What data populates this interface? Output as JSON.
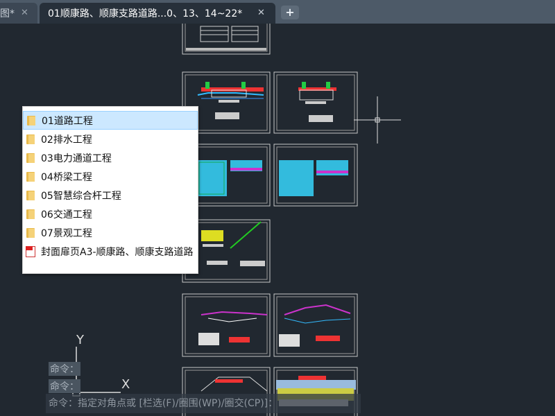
{
  "tabs": [
    {
      "label": "图*",
      "close": "✕"
    },
    {
      "label": "01顺康路、顺康支路道路...0、13、14~22*",
      "close": "✕"
    }
  ],
  "new_tab": "+",
  "popup_items": [
    {
      "label": "01道路工程",
      "icon": "folder-icon",
      "selected": true
    },
    {
      "label": "02排水工程",
      "icon": "folder-icon"
    },
    {
      "label": "03电力通道工程",
      "icon": "folder-icon"
    },
    {
      "label": "04桥梁工程",
      "icon": "folder-icon"
    },
    {
      "label": "05智慧综合杆工程",
      "icon": "folder-icon"
    },
    {
      "label": "06交通工程",
      "icon": "folder-icon"
    },
    {
      "label": "07景观工程",
      "icon": "folder-icon"
    },
    {
      "label": "封面扉页A3-顺康路、顺康支路道路",
      "icon": "pdf-icon"
    }
  ],
  "ucs": {
    "y_label": "Y",
    "x_label": "X"
  },
  "command": {
    "history": [
      "命令：",
      "命令："
    ],
    "prompt": "命令：指定对角点或 [栏选(F)/圈围(WP)/圈交(CP)]："
  },
  "colors": {
    "background": "#212830",
    "tab_active": "#27303a",
    "tab_bar": "#4d5a68",
    "selection": "#cce8ff"
  }
}
